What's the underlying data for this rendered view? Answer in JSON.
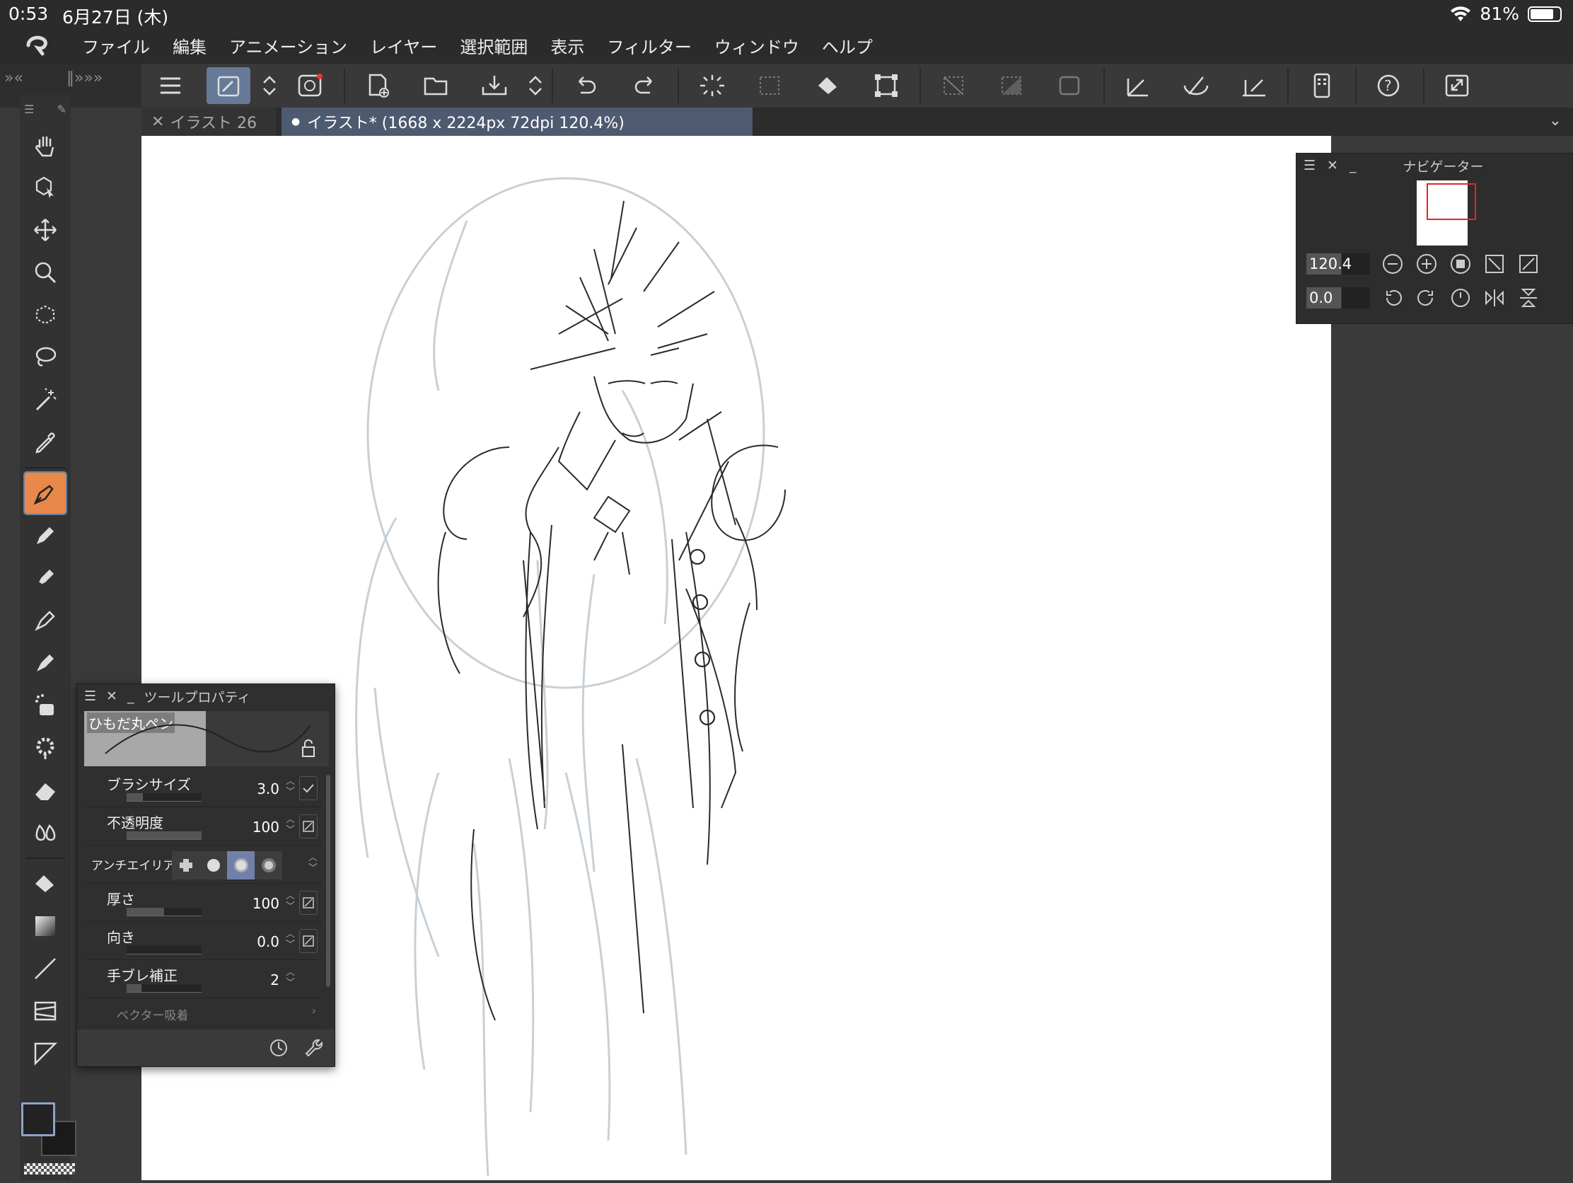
{
  "status": {
    "time": "0:53",
    "date": "6月27日 (木)",
    "battery": "81%",
    "battery_level": 0.81
  },
  "menu": [
    "ファイル",
    "編集",
    "アニメーション",
    "レイヤー",
    "選択範囲",
    "表示",
    "フィルター",
    "ウィンドウ",
    "ヘルプ"
  ],
  "tabs": [
    {
      "label": "イラスト 26",
      "active": false
    },
    {
      "label": "イラスト* (1668 x 2224px 72dpi 120.4%)",
      "active": true
    }
  ],
  "navigator": {
    "title": "ナビゲーター",
    "zoom": "120.4",
    "angle": "0.0"
  },
  "tool_property": {
    "title": "ツールプロパティ",
    "brush_name": "ひもだ丸ペン",
    "rows": [
      {
        "label": "ブラシサイズ",
        "value": "3.0",
        "fill": 0.22
      },
      {
        "label": "不透明度",
        "value": "100",
        "fill": 1.0
      },
      {
        "label": "アンチエイリアス",
        "value": ""
      },
      {
        "label": "厚さ",
        "value": "100",
        "fill": 0.5
      },
      {
        "label": "向き",
        "value": "0.0",
        "fill": 0.0
      },
      {
        "label": "手ブレ補正",
        "value": "2",
        "fill": 0.2
      },
      {
        "label": "ベクター吸着",
        "value": ""
      }
    ]
  },
  "colors": {
    "accent": "#e8884a",
    "tab_active": "#4d5a70",
    "selection": "#667a98"
  }
}
